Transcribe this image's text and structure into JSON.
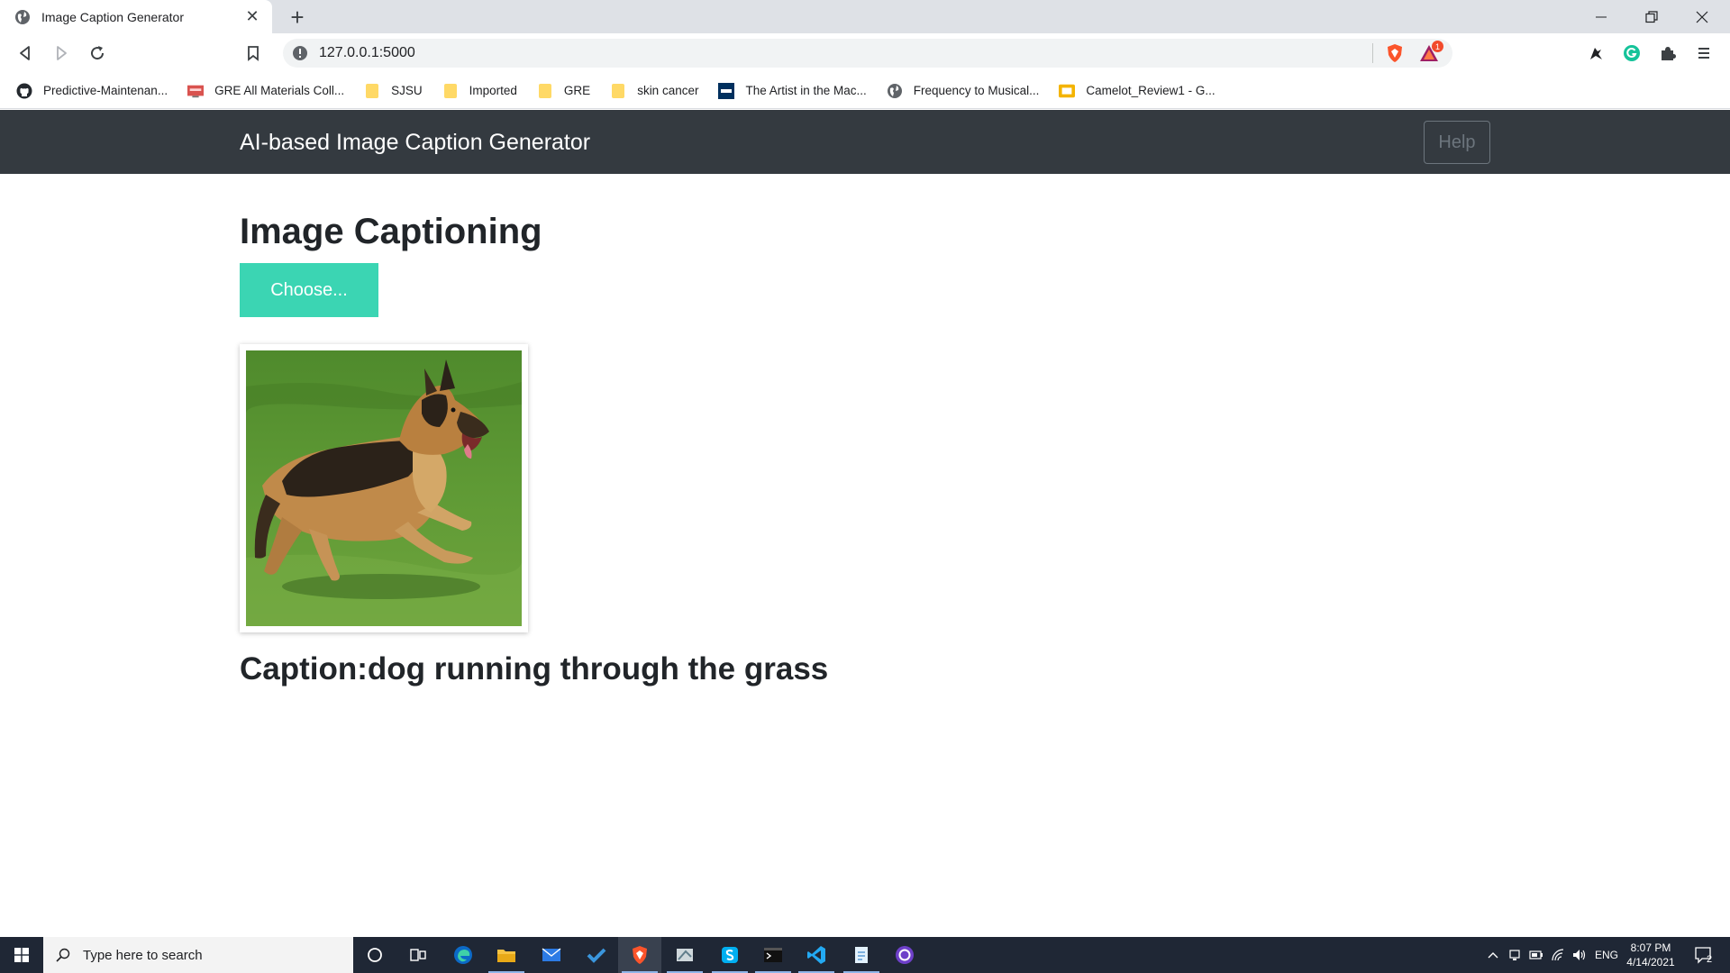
{
  "browser": {
    "tab_title": "Image Caption Generator",
    "url": "127.0.0.1:5000",
    "extension_badge": "1",
    "bookmarks": [
      {
        "label": "Predictive-Maintenan...",
        "icon": "github-icon"
      },
      {
        "label": "GRE All Materials Coll...",
        "icon": "gre-icon"
      },
      {
        "label": "SJSU",
        "icon": "folder-icon"
      },
      {
        "label": "Imported",
        "icon": "folder-icon"
      },
      {
        "label": "GRE",
        "icon": "folder-icon"
      },
      {
        "label": "skin cancer",
        "icon": "folder-icon"
      },
      {
        "label": "The Artist in the Mac...",
        "icon": "ieee-icon"
      },
      {
        "label": "Frequency to Musical...",
        "icon": "globe-icon"
      },
      {
        "label": "Camelot_Review1 - G...",
        "icon": "slides-icon"
      }
    ]
  },
  "navbar": {
    "brand": "AI-based Image Caption Generator",
    "help_label": "Help"
  },
  "main": {
    "heading": "Image Captioning",
    "choose_label": "Choose...",
    "caption": "Caption:dog running through the grass"
  },
  "taskbar": {
    "search_placeholder": "Type here to search",
    "language": "ENG",
    "time": "8:07 PM",
    "date": "4/14/2021",
    "notification_count": "2"
  },
  "colors": {
    "navbar_bg": "#343a40",
    "choose_button": "#3bd5b3",
    "taskbar_bg": "#1f2735"
  }
}
